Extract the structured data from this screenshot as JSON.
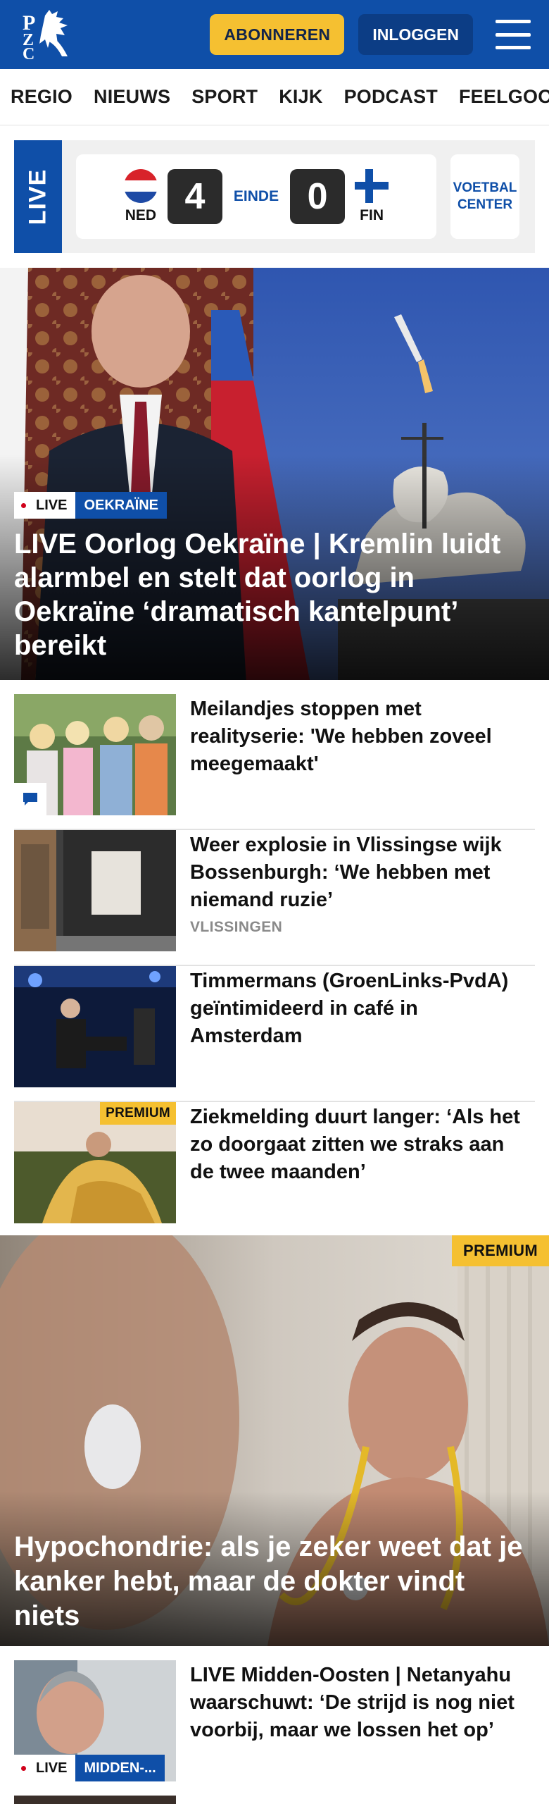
{
  "header": {
    "logo_text": "PZC",
    "subscribe_label": "ABONNEREN",
    "login_label": "INLOGGEN"
  },
  "nav": {
    "items": [
      "REGIO",
      "NIEUWS",
      "SPORT",
      "KIJK",
      "PODCAST",
      "FEELGOOD"
    ]
  },
  "score": {
    "live_label": "LIVE",
    "home_code": "NED",
    "home_goals": "4",
    "status": "EINDE",
    "away_goals": "0",
    "away_code": "FIN",
    "center_label": "VOETBAL CENTER"
  },
  "hero": {
    "live_label": "LIVE",
    "category": "OEKRAÏNE",
    "title": "LIVE Oorlog Oekraïne | Kremlin luidt alarmbel en stelt dat oorlog in Oekraïne ‘dramatisch kantelpunt’ bereikt"
  },
  "articles": [
    {
      "title": "Meilandjes stoppen met realityserie: 'We hebben zoveel meegemaakt'"
    },
    {
      "title": "Weer explosie in Vlissingse wijk Bossenburgh: ‘We hebben met niemand ruzie’",
      "location": "VLISSINGEN"
    },
    {
      "title": "Timmermans (GroenLinks-PvdA) geïntimideerd in café in Amsterdam"
    },
    {
      "title": "Ziekmelding duurt langer: ‘Als het zo doorgaat zitten we straks aan de twee maanden’",
      "badge": "PREMIUM"
    }
  ],
  "feature": {
    "badge": "PREMIUM",
    "title": "Hypochondrie: als je zeker weet dat je kanker hebt, maar de dokter vindt niets"
  },
  "live_article": {
    "live_label": "LIVE",
    "category": "MIDDEN-...",
    "title": "LIVE Midden-Oosten | Netanyahu waarschuwt: ‘De strijd is nog niet voorbij, maar we lossen het op’"
  },
  "colors": {
    "brand_blue": "#0f4fa8",
    "accent_yellow": "#f5c031",
    "live_red": "#d0021b"
  }
}
